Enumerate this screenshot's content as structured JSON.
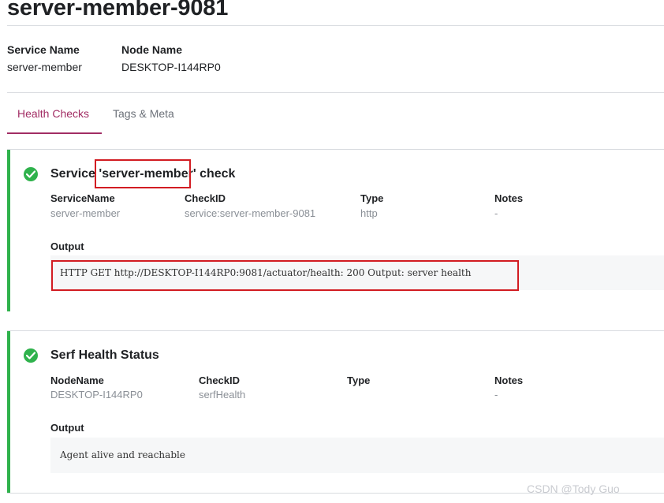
{
  "page": {
    "title": "server-member-9081"
  },
  "meta": {
    "service_name_label": "Service Name",
    "service_name_value": "server-member",
    "node_name_label": "Node Name",
    "node_name_value": "DESKTOP-I144RP0"
  },
  "tabs": [
    {
      "label": "Health Checks",
      "active": true
    },
    {
      "label": "Tags & Meta",
      "active": false
    }
  ],
  "checks": [
    {
      "status": "passing",
      "title_prefix": "Service ",
      "title_highlight": "'server-member'",
      "title_suffix": " check",
      "fields": [
        {
          "label": "ServiceName",
          "value": "server-member"
        },
        {
          "label": "CheckID",
          "value": "service:server-member-9081"
        },
        {
          "label": "Type",
          "value": "http"
        },
        {
          "label": "Notes",
          "value": "-"
        }
      ],
      "output_label": "Output",
      "output": "HTTP GET http://DESKTOP-I144RP0:9081/actuator/health: 200  Output: server health"
    },
    {
      "status": "passing",
      "title": "Serf Health Status",
      "fields": [
        {
          "label": "NodeName",
          "value": "DESKTOP-I144RP0"
        },
        {
          "label": "CheckID",
          "value": "serfHealth"
        },
        {
          "label": "Type",
          "value": ""
        },
        {
          "label": "Notes",
          "value": "-"
        }
      ],
      "output_label": "Output",
      "output": "Agent alive and reachable"
    }
  ],
  "colors": {
    "accent": "#a22d64",
    "passing": "#2fb24c",
    "annotation": "#d21c22"
  },
  "watermark": "CSDN @Tody Guo"
}
